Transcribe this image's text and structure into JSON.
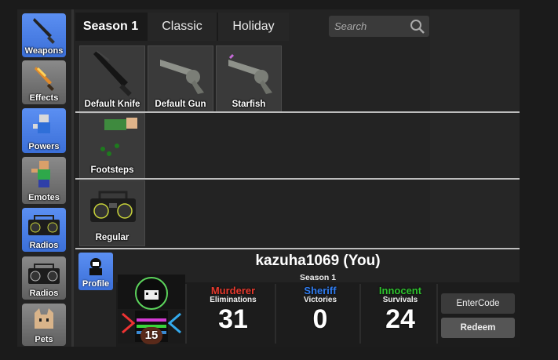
{
  "sidebar": {
    "items": [
      {
        "label": "Weapons",
        "icon": "knife-icon",
        "active": true
      },
      {
        "label": "Effects",
        "icon": "flame-knife-icon",
        "active": false
      },
      {
        "label": "Powers",
        "icon": "running-avatar-icon",
        "active": true
      },
      {
        "label": "Emotes",
        "icon": "emote-avatar-icon",
        "active": false
      },
      {
        "label": "Radios",
        "icon": "boombox-icon",
        "active": true
      },
      {
        "label": "Radios",
        "icon": "boombox-icon",
        "active": false
      },
      {
        "label": "Pets",
        "icon": "cat-pet-icon",
        "active": false
      }
    ]
  },
  "tabs": [
    {
      "label": "Season 1",
      "active": true
    },
    {
      "label": "Classic",
      "active": false
    },
    {
      "label": "Holiday",
      "active": false
    }
  ],
  "search": {
    "placeholder": "Search"
  },
  "items": {
    "weapons": [
      {
        "name": "Default Knife",
        "icon": "knife-icon"
      },
      {
        "name": "Default Gun",
        "icon": "revolver-icon"
      },
      {
        "name": "Starfish",
        "icon": "starfish-revolver-icon"
      }
    ],
    "footsteps": {
      "name": "Footsteps",
      "icon": "footsteps-avatar-icon"
    },
    "radio": {
      "name": "Regular",
      "icon": "boombox-icon"
    }
  },
  "profile": {
    "button_label": "Profile",
    "username": "kazuha1069 (You)",
    "season": "Season 1",
    "level": "15",
    "stats": [
      {
        "role": "Murderer",
        "sub": "Eliminations",
        "value": "31",
        "color": "#e83a2e"
      },
      {
        "role": "Sheriff",
        "sub": "Victories",
        "value": "0",
        "color": "#2f7cf0"
      },
      {
        "role": "Innocent",
        "sub": "Survivals",
        "value": "24",
        "color": "#2ec32e"
      }
    ],
    "enter_code_label": "EnterCode",
    "redeem_label": "Redeem"
  },
  "colors": {
    "accent_blue": "#4a80e8",
    "panel": "#232323"
  }
}
